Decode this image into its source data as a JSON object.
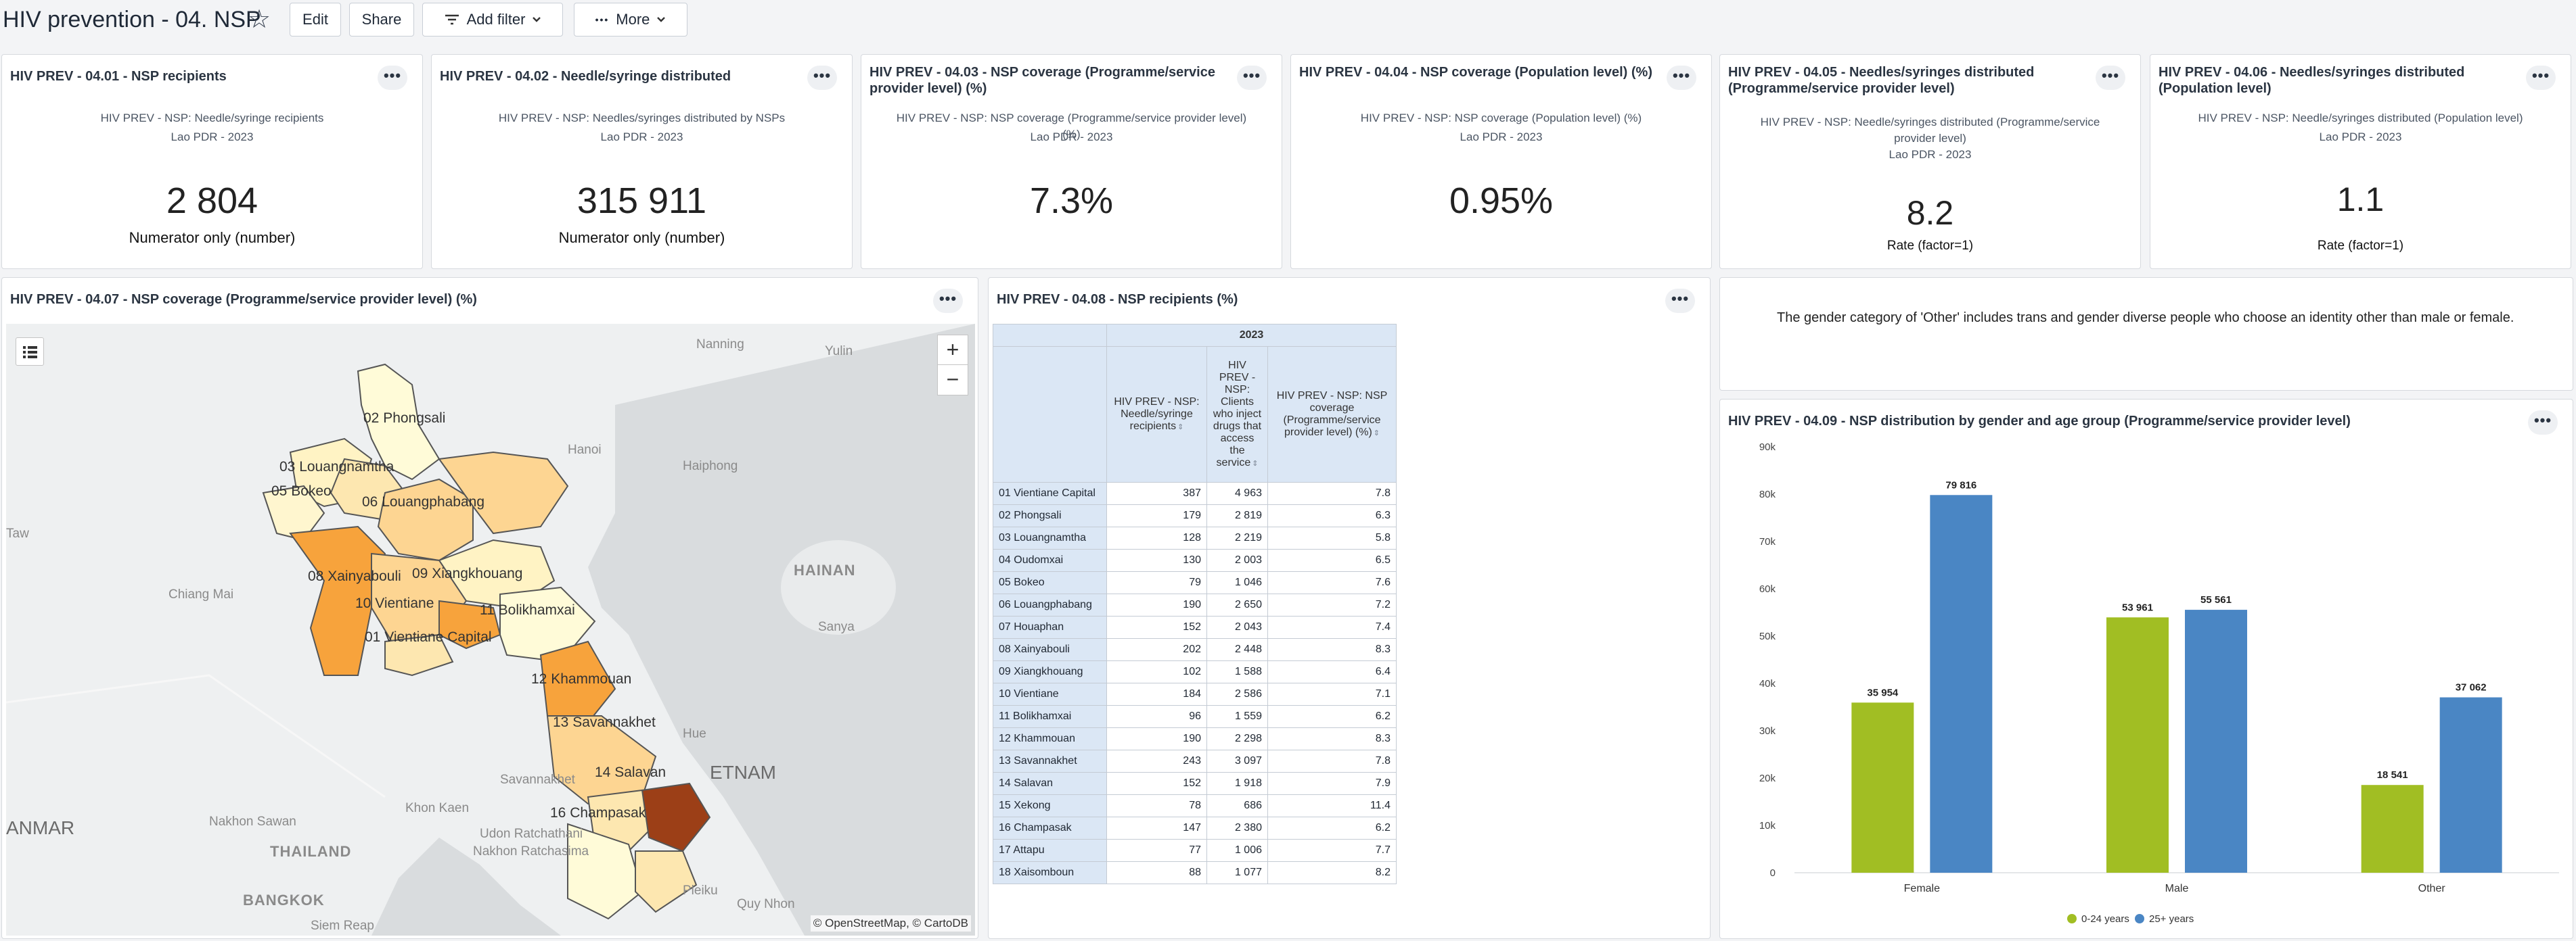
{
  "header": {
    "title": "HIV prevention - 04. NSP",
    "edit": "Edit",
    "share": "Share",
    "add_filter": "Add filter",
    "more": "More"
  },
  "more_glyph": "•••",
  "kpis": [
    {
      "title": "HIV PREV - 04.01 - NSP recipients",
      "subtitle": "HIV PREV - NSP: Needle/syringe recipients",
      "period": "Lao PDR - 2023",
      "value": "2 804",
      "unit": "Numerator only (number)"
    },
    {
      "title": "HIV PREV - 04.02 - Needle/syringe distributed",
      "subtitle": "HIV PREV - NSP: Needles/syringes distributed by NSPs",
      "period": "Lao PDR - 2023",
      "value": "315 911",
      "unit": "Numerator only (number)"
    },
    {
      "title": "HIV PREV - 04.03 - NSP coverage (Programme/service provider level) (%)",
      "subtitle": "HIV PREV - NSP: NSP coverage (Programme/service provider level) (%)",
      "period": "Lao PDR - 2023",
      "value": "7.3%",
      "unit": ""
    },
    {
      "title": "HIV PREV - 04.04 - NSP coverage (Population level) (%)",
      "subtitle": "HIV PREV - NSP: NSP coverage (Population level) (%)",
      "period": "Lao PDR - 2023",
      "value": "0.95%",
      "unit": ""
    },
    {
      "title": "HIV PREV - 04.05 - Needles/syringes distributed (Programme/service provider level)",
      "subtitle": "HIV PREV - NSP: Needle/syringes distributed (Programme/service provider level)",
      "period": "Lao PDR - 2023",
      "value": "8.2",
      "unit": "Rate (factor=1)"
    },
    {
      "title": "HIV PREV - 04.06 - Needles/syringes distributed (Population level)",
      "subtitle": "HIV PREV - NSP: Needle/syringes distributed (Population level)",
      "period": "Lao PDR - 2023",
      "value": "1.1",
      "unit": "Rate (factor=1)"
    }
  ],
  "map": {
    "title": "HIV PREV - 04.07 - NSP coverage (Programme/service provider level) (%)",
    "attribution": "© OpenStreetMap, © CartoDB",
    "zoom_in": "+",
    "zoom_out": "−",
    "province_labels": [
      "02 Phongsali",
      "03 Louangnamtha",
      "05 Bokeo",
      "06 Louangphabang",
      "08 Xainyabouli",
      "10 Vientiane",
      "09 Xiangkhouang",
      "11 Bolikhamxai",
      "01 Vientiane Capital",
      "12 Khammouan",
      "13 Savannakhet",
      "14 Salavan",
      "16 Champasak"
    ],
    "geo_labels": [
      "Nanning",
      "Yulin",
      "Hanoi",
      "Haiphong",
      "Taw",
      "Chiang Mai",
      "HAINAN",
      "Sanya",
      "Hue",
      "Savannakhet",
      "Khon Kaen",
      "Nakhon Sawan",
      "Udon Ratchathani",
      "THAILAND",
      "Nakhon Ratchasima",
      "BANGKOK",
      "Pleiku",
      "Quy Nhon",
      "Siem Reap",
      "ETNAM",
      "ANMAR"
    ]
  },
  "table": {
    "title": "HIV PREV - 04.08 - NSP recipients (%)",
    "year": "2023",
    "headers": [
      "HIV PREV - NSP: Needle/syringe recipients",
      "HIV PREV - NSP: Clients who inject drugs that access the service",
      "HIV PREV - NSP: NSP coverage (Programme/service provider level) (%)"
    ],
    "rows": [
      [
        "01 Vientiane Capital",
        "387",
        "4 963",
        "7.8"
      ],
      [
        "02 Phongsali",
        "179",
        "2 819",
        "6.3"
      ],
      [
        "03 Louangnamtha",
        "128",
        "2 219",
        "5.8"
      ],
      [
        "04 Oudomxai",
        "130",
        "2 003",
        "6.5"
      ],
      [
        "05 Bokeo",
        "79",
        "1 046",
        "7.6"
      ],
      [
        "06 Louangphabang",
        "190",
        "2 650",
        "7.2"
      ],
      [
        "07 Houaphan",
        "152",
        "2 043",
        "7.4"
      ],
      [
        "08 Xainyabouli",
        "202",
        "2 448",
        "8.3"
      ],
      [
        "09 Xiangkhouang",
        "102",
        "1 588",
        "6.4"
      ],
      [
        "10 Vientiane",
        "184",
        "2 586",
        "7.1"
      ],
      [
        "11 Bolikhamxai",
        "96",
        "1 559",
        "6.2"
      ],
      [
        "12 Khammouan",
        "190",
        "2 298",
        "8.3"
      ],
      [
        "13 Savannakhet",
        "243",
        "3 097",
        "7.8"
      ],
      [
        "14 Salavan",
        "152",
        "1 918",
        "7.9"
      ],
      [
        "15 Xekong",
        "78",
        "686",
        "11.4"
      ],
      [
        "16 Champasak",
        "147",
        "2 380",
        "6.2"
      ],
      [
        "17 Attapu",
        "77",
        "1 006",
        "7.7"
      ],
      [
        "18 Xaisomboun",
        "88",
        "1 077",
        "8.2"
      ]
    ]
  },
  "note": {
    "text": "The gender category of 'Other' includes trans and gender diverse people who choose an identity other than male or female."
  },
  "chart_data": {
    "type": "bar",
    "title": "HIV PREV - 04.09 - NSP distribution by gender and age group (Programme/service provider level)",
    "categories": [
      "Female",
      "Male",
      "Other"
    ],
    "series": [
      {
        "name": "0-24 years",
        "values": [
          35954,
          53961,
          18541
        ],
        "labels": [
          "35 954",
          "53 961",
          "18 541"
        ],
        "color": "#a1be23"
      },
      {
        "name": "25+ years",
        "values": [
          79816,
          55561,
          37062
        ],
        "labels": [
          "79 816",
          "55 561",
          "37 062"
        ],
        "color": "#4a86c4"
      }
    ],
    "ylim": [
      0,
      90000
    ],
    "yticks": [
      0,
      10000,
      20000,
      30000,
      40000,
      50000,
      60000,
      70000,
      80000,
      90000
    ],
    "ytick_labels": [
      "0",
      "10k",
      "20k",
      "30k",
      "40k",
      "50k",
      "60k",
      "70k",
      "80k",
      "90k"
    ],
    "grid": false,
    "legend": "bottom"
  }
}
